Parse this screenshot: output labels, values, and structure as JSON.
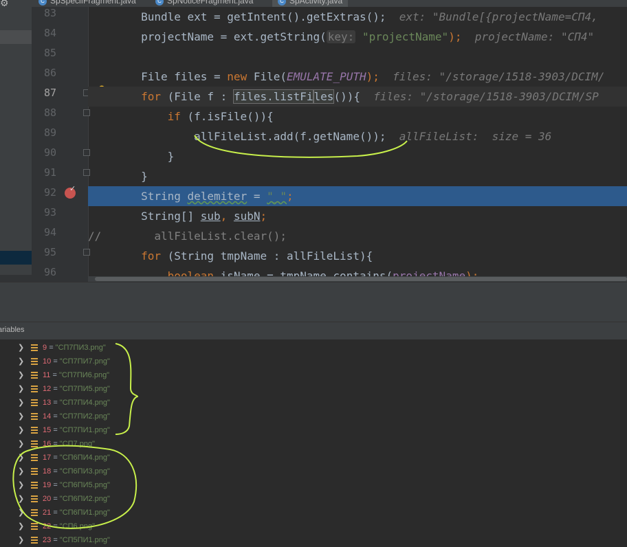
{
  "tabs": [
    {
      "label": "SpSpecifFragment.java",
      "active": false
    },
    {
      "label": "SpNoticeFragment.java",
      "active": false
    },
    {
      "label": "SpActivity.java",
      "active": true
    }
  ],
  "editor": {
    "line_numbers": [
      "83",
      "84",
      "85",
      "86",
      "87",
      "88",
      "89",
      "90",
      "91",
      "92",
      "93",
      "94",
      "95",
      "96"
    ],
    "current_line": "87",
    "breakpoint_line": "92"
  },
  "code": {
    "l83": {
      "a": "        Bundle ext = getIntent().getExtras();",
      "hint": "  ext: \"Bundle[{projectName=СП4, "
    },
    "l84": {
      "a": "        projectName = ext.getString(",
      "key": "key:",
      "b": " ",
      "str": "\"projectName\"",
      "c": ");",
      "hint": "  projectName: \"СП4\"  "
    },
    "l86": {
      "a": "        File files = ",
      "kw": "new",
      "b": " File(",
      "const": "EMULATE_PUTH",
      "c": ");",
      "hint": "  files: \"/storage/1518-3903/DCIM/"
    },
    "l87": {
      "kw": "for",
      "a": " (File f : ",
      "box": "files.listFi",
      "caret": "les",
      "b": "()){",
      "hint": "  files: \"/storage/1518-3903/DCIM/SP"
    },
    "l88": {
      "kw": "if",
      "a": " (f.isFile()){"
    },
    "l89": {
      "a": "allFileList.add(f.getName());",
      "hint": "  allFileList:  size = 36"
    },
    "l90": {
      "a": "}"
    },
    "l91": {
      "a": "}"
    },
    "l92": {
      "a": "String ",
      "ul": "delemiter",
      "b": " = ",
      "str": "\"_\"",
      "c": ";"
    },
    "l93": {
      "a": "String[] ",
      "ul1": "sub",
      "b": ", ",
      "ul2": "subN",
      "c": ";"
    },
    "l94": {
      "cmt": "//",
      "a": "        allFileList.clear();"
    },
    "l95": {
      "kw": "for",
      "a": " (String tmpName : allFileList){"
    },
    "l96": {
      "kw": "boolean",
      "a": " isName = tmpName.contains(",
      "var": "projectName",
      "b": ");"
    }
  },
  "debugger": {
    "panel_title": "ariables",
    "items": [
      {
        "index": "9",
        "value": "\"СП7ПИ3.png\""
      },
      {
        "index": "10",
        "value": "\"СП7ПИ7.png\""
      },
      {
        "index": "11",
        "value": "\"СП7ПИ6.png\""
      },
      {
        "index": "12",
        "value": "\"СП7ПИ5.png\""
      },
      {
        "index": "13",
        "value": "\"СП7ПИ4.png\""
      },
      {
        "index": "14",
        "value": "\"СП7ПИ2.png\""
      },
      {
        "index": "15",
        "value": "\"СП7ПИ1.png\""
      },
      {
        "index": "16",
        "value": "\"СП7.png\""
      },
      {
        "index": "17",
        "value": "\"СП6ПИ4.png\""
      },
      {
        "index": "18",
        "value": "\"СП6ПИ3.png\""
      },
      {
        "index": "19",
        "value": "\"СП6ПИ5.png\""
      },
      {
        "index": "20",
        "value": "\"СП6ПИ2.png\""
      },
      {
        "index": "21",
        "value": "\"СП6ПИ1.png\""
      },
      {
        "index": "22",
        "value": "\"СП6.png\""
      },
      {
        "index": "23",
        "value": "\"СП5ПИ1.png\""
      }
    ]
  },
  "colors": {
    "keyword": "#cc7832",
    "string": "#6a8759",
    "field": "#9876aa",
    "annotation": "#c8f04b",
    "execution_line": "#2d5a8c"
  }
}
